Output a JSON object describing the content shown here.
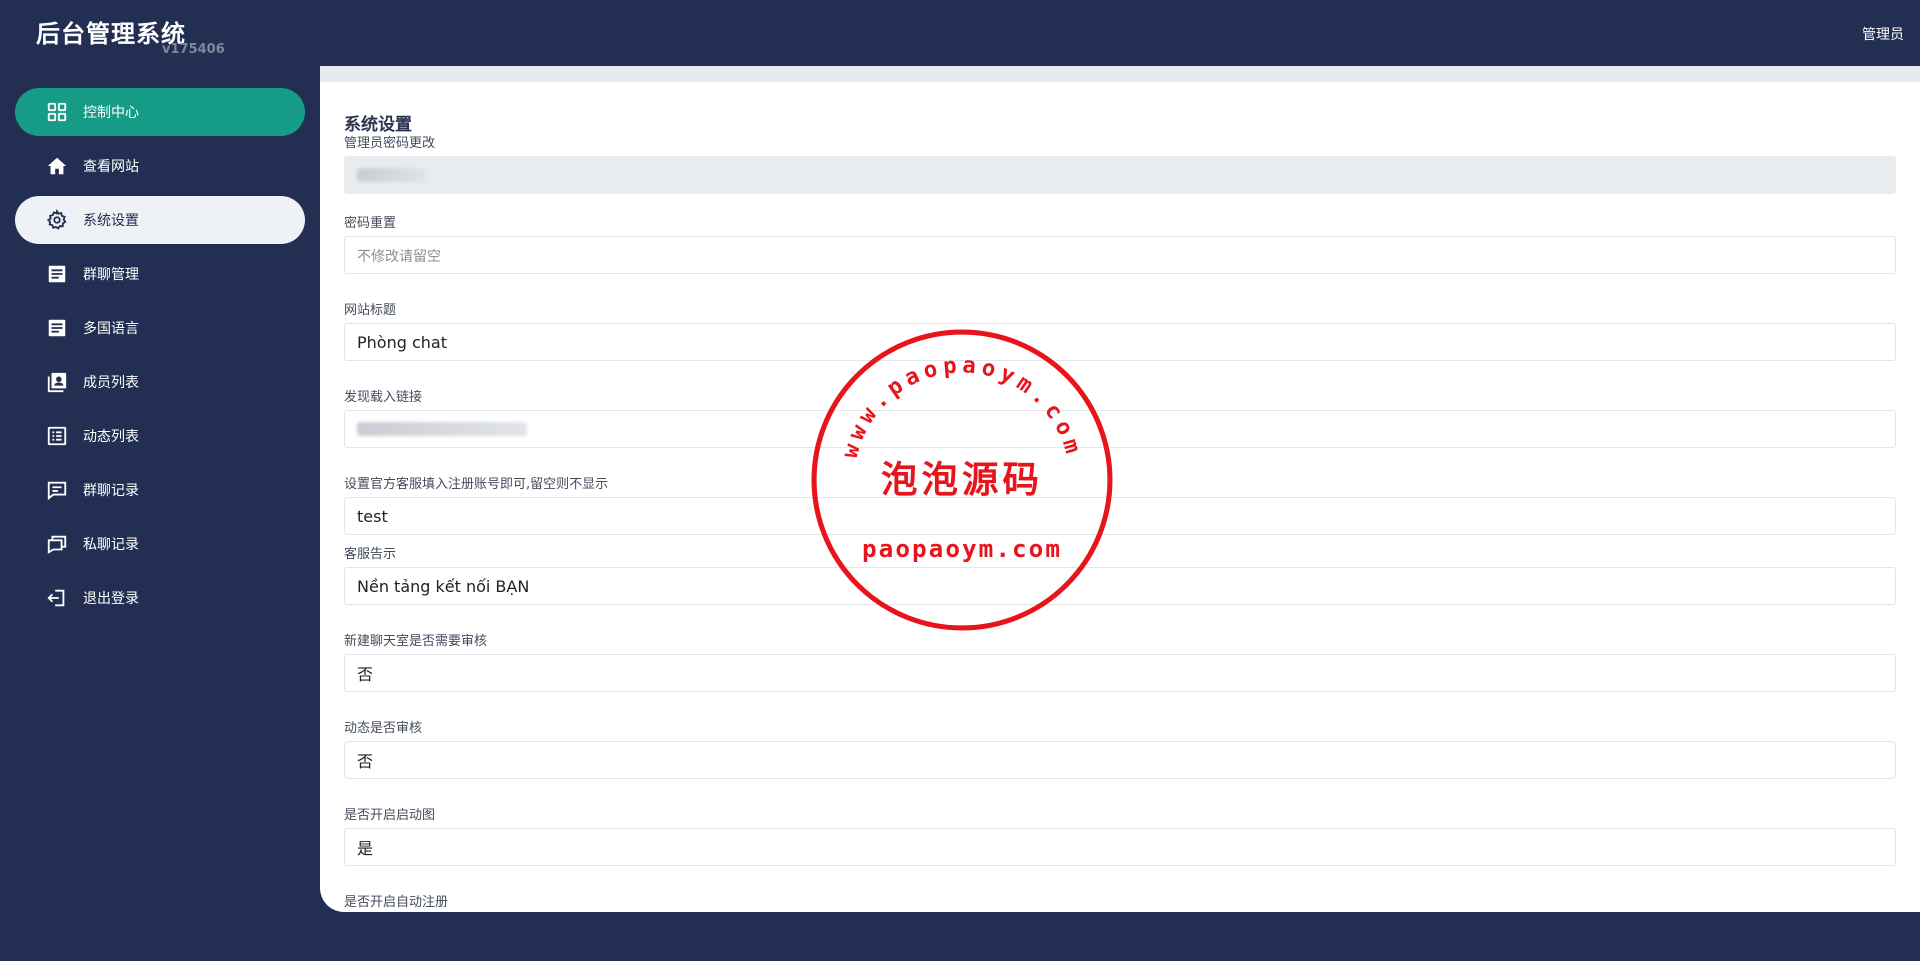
{
  "brand": {
    "title": "后台管理系统",
    "version": "v175406"
  },
  "header": {
    "user": "管理员"
  },
  "sidebar": {
    "items": [
      {
        "label": "控制中心",
        "icon": "dashboard-icon"
      },
      {
        "label": "查看网站",
        "icon": "home-icon"
      },
      {
        "label": "系统设置",
        "icon": "gear-icon"
      },
      {
        "label": "群聊管理",
        "icon": "document-icon"
      },
      {
        "label": "多国语言",
        "icon": "document-icon"
      },
      {
        "label": "成员列表",
        "icon": "contacts-icon"
      },
      {
        "label": "动态列表",
        "icon": "list-icon"
      },
      {
        "label": "群聊记录",
        "icon": "comment-icon"
      },
      {
        "label": "私聊记录",
        "icon": "chat-icon"
      },
      {
        "label": "退出登录",
        "icon": "logout-icon"
      }
    ]
  },
  "main": {
    "title": "系统设置",
    "fields": [
      {
        "label": "管理员密码更改",
        "value": ""
      },
      {
        "label": "密码重置",
        "value": "",
        "placeholder": "不修改请留空"
      },
      {
        "label": "网站标题",
        "value": "Phòng chat"
      },
      {
        "label": "发现载入链接",
        "value": ""
      },
      {
        "label": "设置官方客服填入注册账号即可,留空则不显示",
        "value": "test"
      },
      {
        "label": "客服告示",
        "value": "Nền tảng kết nối BẠN"
      },
      {
        "label": "新建聊天室是否需要审核",
        "value": "否"
      },
      {
        "label": "动态是否审核",
        "value": "否"
      },
      {
        "label": "是否开启启动图",
        "value": "是"
      },
      {
        "label": "是否开启自动注册",
        "value": ""
      }
    ]
  },
  "watermark": {
    "ring_text": "www.paopaoym.com",
    "center_text": "泡泡源码",
    "bottom_text": "paopaoym.com",
    "color": "#e8141b"
  }
}
